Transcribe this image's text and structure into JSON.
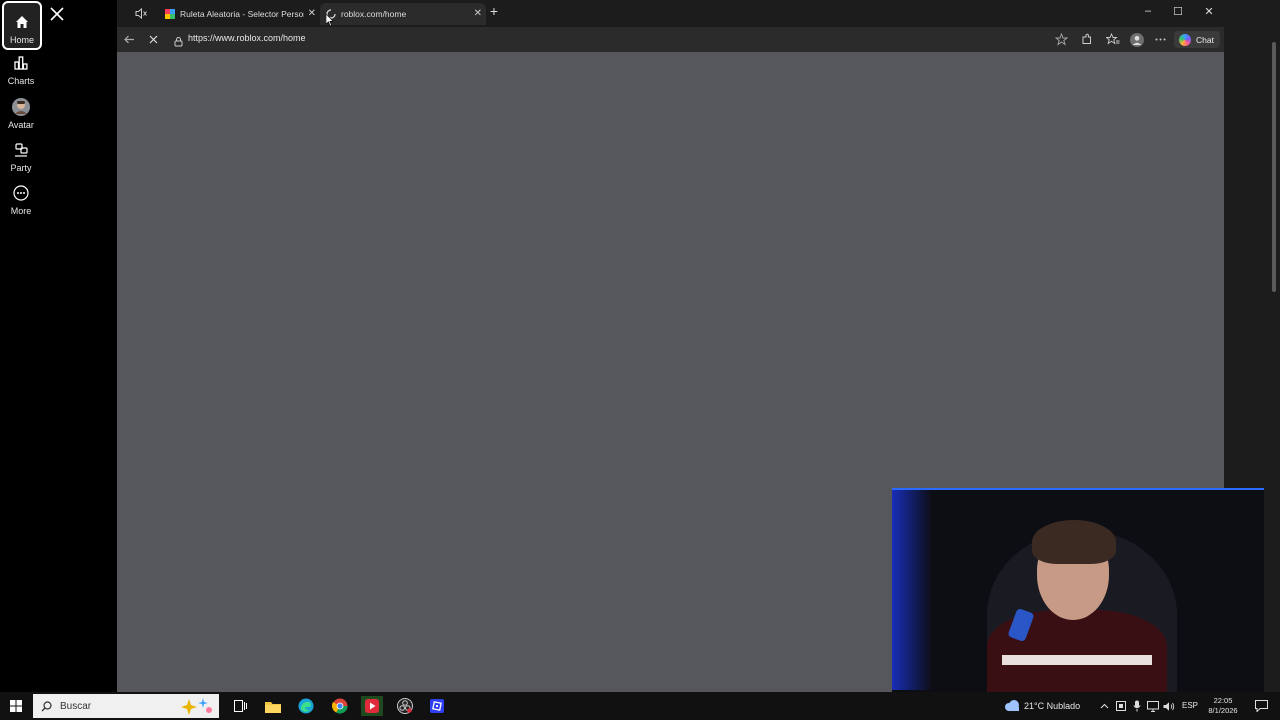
{
  "sidebar": {
    "items": [
      {
        "label": "Home"
      },
      {
        "label": "Charts"
      },
      {
        "label": "Avatar"
      },
      {
        "label": "Party"
      },
      {
        "label": "More"
      }
    ]
  },
  "browser": {
    "tabs": [
      {
        "title": "Ruleta Aleatoria - Selector Personajes"
      },
      {
        "title": "roblox.com/home"
      }
    ],
    "address": "https://www.roblox.com/home",
    "chat_label": "Chat"
  },
  "taskbar": {
    "search_placeholder": "Buscar",
    "weather": "21°C  Nublado",
    "language": "ESP",
    "time": "22:05",
    "date": "8/1/2026"
  }
}
